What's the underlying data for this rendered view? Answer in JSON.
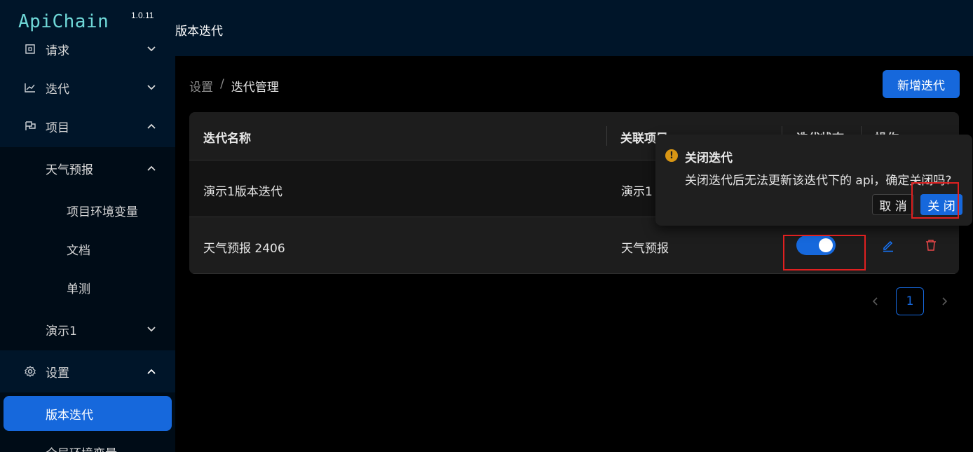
{
  "app": {
    "logo": "ApiChain",
    "version": "1.0.11"
  },
  "header": {
    "title": "版本迭代"
  },
  "sidebar": {
    "items": [
      {
        "label": "请求",
        "icon": "request-icon",
        "expanded": false
      },
      {
        "label": "迭代",
        "icon": "chart-line-icon",
        "expanded": false
      },
      {
        "label": "项目",
        "icon": "project-flag-icon",
        "expanded": true
      },
      {
        "label": "设置",
        "icon": "gear-icon",
        "expanded": true
      }
    ],
    "project_children": [
      {
        "label": "天气预报",
        "expanded": true
      },
      {
        "label": "项目环境变量"
      },
      {
        "label": "文档"
      },
      {
        "label": "单测"
      },
      {
        "label": "演示1",
        "expanded": false
      }
    ],
    "settings_children": [
      {
        "label": "版本迭代",
        "active": true
      },
      {
        "label": "全局环境变量"
      }
    ]
  },
  "breadcrumb": {
    "parent": "设置",
    "separator": "/",
    "current": "迭代管理"
  },
  "toolbar": {
    "add_label": "新增迭代"
  },
  "table": {
    "columns": [
      "迭代名称",
      "关联项目",
      "迭代状态",
      "操作"
    ],
    "rows": [
      {
        "name": "演示1版本迭代",
        "project": "演示1"
      },
      {
        "name": "天气预报 2406",
        "project": "天气预报",
        "status_on": true
      }
    ]
  },
  "pagination": {
    "current_page": "1"
  },
  "popconfirm": {
    "title": "关闭迭代",
    "description": "关闭迭代后无法更新该迭代下的 api，确定关闭吗?",
    "cancel_label": "取 消",
    "ok_label": "关 闭"
  },
  "colors": {
    "primary": "#1668dc",
    "sidebar_bg": "#001529",
    "warning": "#d89614",
    "danger": "#e84749",
    "highlight": "#e02020"
  }
}
